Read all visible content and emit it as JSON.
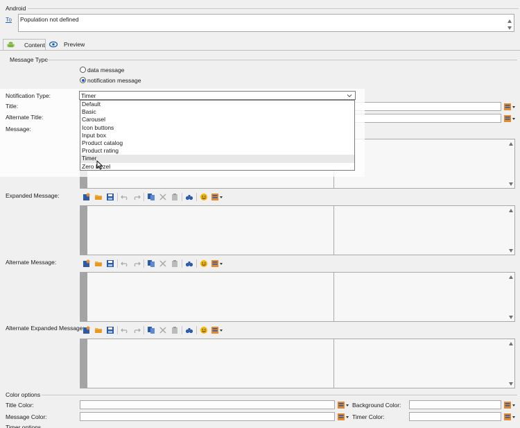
{
  "header": {
    "section_title": "Android",
    "to_link": "To",
    "to_value": "Population not defined"
  },
  "tabs": [
    {
      "label": "Content",
      "icon": "android-icon"
    },
    {
      "label": "Preview",
      "icon": "eye-icon"
    }
  ],
  "message_type": {
    "group_label": "Message Type",
    "options": [
      {
        "label": "data message",
        "selected": false
      },
      {
        "label": "notification message",
        "selected": true
      }
    ]
  },
  "form": {
    "notification_type_label": "Notification Type:",
    "notification_type_value": "Timer",
    "title_label": "Title:",
    "alternate_title_label": "Alternate Title:",
    "message_label": "Message:",
    "expanded_message_label": "Expanded Message:",
    "alternate_message_label": "Alternate Message:",
    "alternate_expanded_message_label": "Alternate Expanded Message:"
  },
  "dropdown": {
    "options": [
      "Default",
      "Basic",
      "Carousel",
      "Icon buttons",
      "Input box",
      "Product catalog",
      "Product rating",
      "Timer",
      "Zero Bezel"
    ],
    "hovered": "Timer"
  },
  "color_options": {
    "group_label": "Color options",
    "title_color_label": "Title Color:",
    "background_color_label": "Background Color:",
    "message_color_label": "Message Color:",
    "timer_color_label": "Timer Color:"
  },
  "timer_options": {
    "group_label": "Timer options"
  },
  "colors": {
    "accent": "#1a5fb4",
    "link": "#1a5fb4",
    "gutter": "#a4a4a4",
    "pers_orange": "#e8892a",
    "pers_blue": "#2a5aa8"
  }
}
